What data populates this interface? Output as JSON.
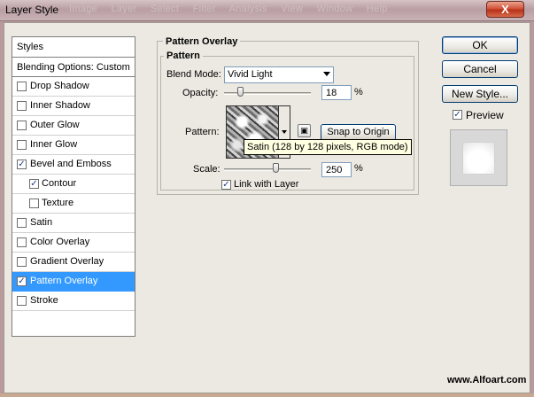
{
  "window": {
    "title": "Layer Style",
    "background_menu": [
      "Image",
      "Layer",
      "Select",
      "Filter",
      "Analysis",
      "View",
      "Window",
      "Help"
    ],
    "close_label": "X"
  },
  "styles_panel": {
    "header": "Styles",
    "blending_options": "Blending Options: Custom",
    "items": [
      {
        "label": "Drop Shadow",
        "checked": false,
        "sub": false,
        "selected": false
      },
      {
        "label": "Inner Shadow",
        "checked": false,
        "sub": false,
        "selected": false
      },
      {
        "label": "Outer Glow",
        "checked": false,
        "sub": false,
        "selected": false
      },
      {
        "label": "Inner Glow",
        "checked": false,
        "sub": false,
        "selected": false
      },
      {
        "label": "Bevel and Emboss",
        "checked": true,
        "sub": false,
        "selected": false
      },
      {
        "label": "Contour",
        "checked": true,
        "sub": true,
        "selected": false
      },
      {
        "label": "Texture",
        "checked": false,
        "sub": true,
        "selected": false
      },
      {
        "label": "Satin",
        "checked": false,
        "sub": false,
        "selected": false
      },
      {
        "label": "Color Overlay",
        "checked": false,
        "sub": false,
        "selected": false
      },
      {
        "label": "Gradient Overlay",
        "checked": false,
        "sub": false,
        "selected": false
      },
      {
        "label": "Pattern Overlay",
        "checked": true,
        "sub": false,
        "selected": true
      },
      {
        "label": "Stroke",
        "checked": false,
        "sub": false,
        "selected": false
      }
    ]
  },
  "pattern_overlay": {
    "group_title": "Pattern Overlay",
    "subgroup_title": "Pattern",
    "blend_mode_label": "Blend Mode:",
    "blend_mode_value": "Vivid Light",
    "opacity_label": "Opacity:",
    "opacity_value": "18",
    "opacity_unit": "%",
    "opacity_level": 0.18,
    "pattern_label": "Pattern:",
    "pattern_tooltip": "Satin (128 by 128 pixels, RGB mode)",
    "snap_button": "Snap to Origin",
    "scale_label": "Scale:",
    "scale_value": "250",
    "scale_unit": "%",
    "link_label": "Link with Layer",
    "link_checked": true
  },
  "actions": {
    "ok": "OK",
    "reset": "Cancel",
    "new_style": "New Style...",
    "preview_label": "Preview",
    "preview_checked": true
  },
  "watermark": "www.Alfoart.com",
  "checkmark": "✓"
}
